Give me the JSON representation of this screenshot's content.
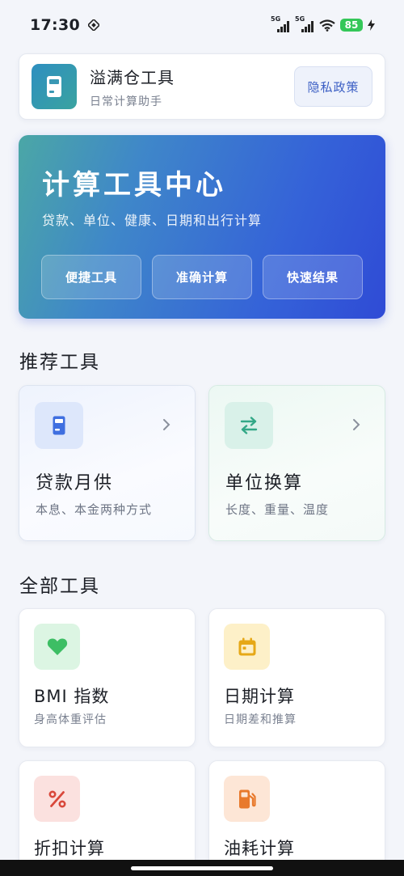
{
  "status_bar": {
    "time": "17:30",
    "network_1": "5G",
    "network_2": "5G",
    "battery": "85"
  },
  "app_header": {
    "name": "溢满仓工具",
    "subtitle": "日常计算助手",
    "privacy_button": "隐私政策"
  },
  "hero": {
    "title": "计算工具中心",
    "subtitle": "贷款、单位、健康、日期和出行计算",
    "buttons": [
      "便捷工具",
      "准确计算",
      "快速结果"
    ]
  },
  "recommended": {
    "section_title": "推荐工具",
    "items": [
      {
        "title": "贷款月供",
        "desc": "本息、本金两种方式",
        "icon": "calculator-icon"
      },
      {
        "title": "单位换算",
        "desc": "长度、重量、温度",
        "icon": "swap-arrows-icon"
      }
    ]
  },
  "all_tools": {
    "section_title": "全部工具",
    "items": [
      {
        "title": "BMI 指数",
        "desc": "身高体重评估",
        "icon": "heart-icon"
      },
      {
        "title": "日期计算",
        "desc": "日期差和推算",
        "icon": "calendar-icon"
      },
      {
        "title": "折扣计算",
        "desc": "",
        "icon": "percent-icon"
      },
      {
        "title": "油耗计算",
        "desc": "",
        "icon": "fuel-pump-icon"
      }
    ]
  },
  "colors": {
    "accent": "#3563d8",
    "heart": "#3dbe64",
    "calendar": "#e6a817",
    "percent": "#d9483b",
    "fuel": "#e8792c"
  }
}
